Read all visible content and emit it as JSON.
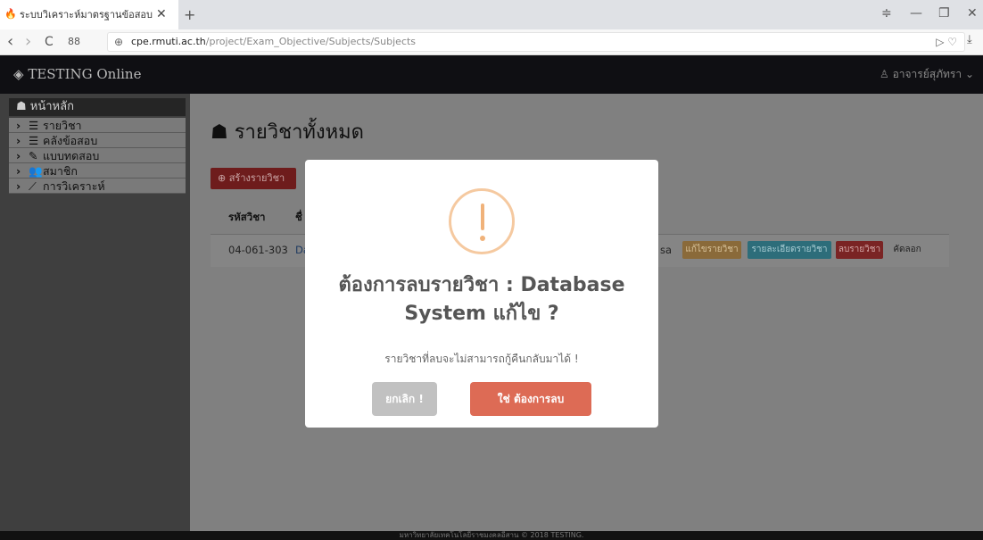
{
  "browser": {
    "tab_title": "ระบบวิเคราะห์มาตรฐานข้อสอบ",
    "tab_close": "✕",
    "new_tab": "+",
    "back": "‹",
    "forward": "›",
    "reload": "C",
    "apps": "88",
    "url_host": "cpe.rmuti.ac.th",
    "url_path": "/project/Exam_Objective/Subjects/Subjects",
    "url_right": "▷ ♡",
    "menu_icon": "≑",
    "minimize": "—",
    "restore": "❐",
    "close": "✕",
    "download": "⤓"
  },
  "navbar": {
    "brand": "TESTING Online",
    "brand_icon": "◈",
    "user": "อาจารย์สุภัทรา",
    "user_icon": "♙",
    "caret": "⌄"
  },
  "sidebar": {
    "home": "หน้าหลัก",
    "home_icon": "☗",
    "items": [
      {
        "label": "รายวิชา",
        "icon": "☰"
      },
      {
        "label": "คลังข้อสอบ",
        "icon": "☰"
      },
      {
        "label": "แบบทดสอบ",
        "icon": "✎"
      },
      {
        "label": "สมาชิก",
        "icon": "👥"
      },
      {
        "label": "การวิเคราะห์",
        "icon": "⟋"
      }
    ],
    "chevron": "›"
  },
  "page": {
    "title": "รายวิชาทั้งหมด",
    "title_icon": "☗",
    "create_button": "สร้างรายวิชา",
    "create_icon": "⊕",
    "table": {
      "headers": [
        "รหัสวิชา",
        "ชื่"
      ],
      "row": {
        "code": "04-061-303",
        "name_fragment": "Da",
        "owner_fragment": "sa",
        "actions": [
          "แก้ไขรายวิชา",
          "รายละเอียดรายวิชา",
          "ลบรายวิชา",
          "คัดลอก"
        ]
      }
    }
  },
  "footer": {
    "text": "มหาวิทยาลัยเทคโนโลยีราชมงคลอีสาน © 2018 TESTING."
  },
  "modal": {
    "title": "ต้องการลบรายวิชา : Database System แก้ไข ?",
    "text": "รายวิชาที่ลบจะไม่สามารถกู้คืนกลับมาได้ !",
    "cancel": "ยกเลิก !",
    "confirm": "ใช่ ต้องการลบ"
  },
  "colors": {
    "warning": "#f0b27a",
    "confirm": "#dd6b55",
    "cancel": "#c1c1c1",
    "edit_btn": "#8a6a3a",
    "detail_btn": "#2d6d7a",
    "delete_btn": "#7a2424"
  }
}
